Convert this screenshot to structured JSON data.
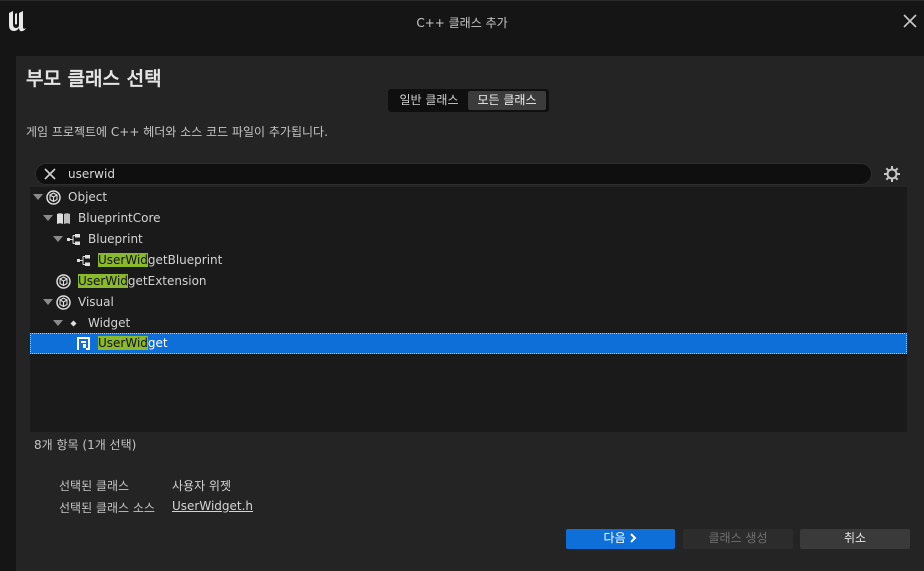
{
  "window": {
    "title": "C++ 클래스 추가"
  },
  "heading": "부모 클래스 선택",
  "tabs": {
    "general_label": "일반 클래스",
    "all_label": "모든 클래스"
  },
  "description": "게임 프로젝트에 C++ 헤더와 소스 코드 파일이 추가됩니다.",
  "search": {
    "value": "userwid"
  },
  "tree": {
    "items": [
      {
        "label": "Object",
        "highlight": "",
        "rest": "Object"
      },
      {
        "label": "BlueprintCore",
        "highlight": "",
        "rest": "BlueprintCore"
      },
      {
        "label": "Blueprint",
        "highlight": "",
        "rest": "Blueprint"
      },
      {
        "label": "UserWidgetBlueprint",
        "highlight": "UserWid",
        "rest": "getBlueprint"
      },
      {
        "label": "UserWidgetExtension",
        "highlight": "UserWid",
        "rest": "getExtension"
      },
      {
        "label": "Visual",
        "highlight": "",
        "rest": "Visual"
      },
      {
        "label": "Widget",
        "highlight": "",
        "rest": "Widget"
      },
      {
        "label": "UserWidget",
        "highlight": "UserWid",
        "rest": "get"
      }
    ]
  },
  "status": {
    "count": "8개 항목 (1개 선택)"
  },
  "selection": {
    "class_label": "선택된 클래스",
    "class_value": "사용자 위젯",
    "source_label": "선택된 클래스 소스",
    "source_value": "UserWidget.h"
  },
  "buttons": {
    "next": "다음",
    "create": "클래스 생성",
    "cancel": "취소"
  },
  "colors": {
    "accent": "#0e6fd8",
    "match_highlight": "#8ab92c",
    "panel": "#242424",
    "background": "#151515"
  },
  "icons": {
    "logo": "unreal-logo-icon",
    "close": "close-icon",
    "clear": "clear-search-icon",
    "settings": "gear-icon",
    "object": "object-class-icon",
    "book": "book-icon",
    "blueprint": "blueprint-icon",
    "widget": "widget-diamond-icon",
    "user_widget": "user-widget-icon"
  }
}
